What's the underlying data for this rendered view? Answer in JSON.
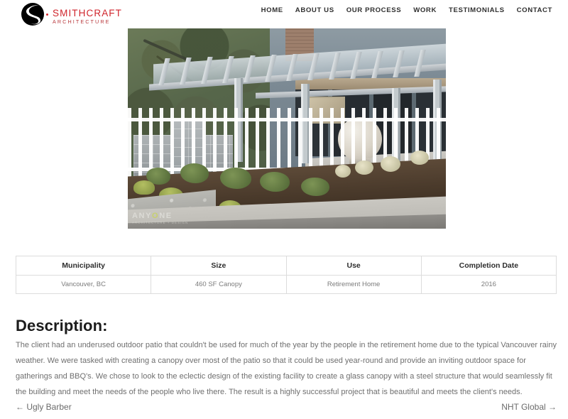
{
  "header": {
    "logo": {
      "name": "SMITHCRAFT",
      "subtitle": "ARCHITECTURE",
      "mark_color": "#000000",
      "name_color": "#d0252c"
    },
    "nav": [
      {
        "label": "HOME"
      },
      {
        "label": "ABOUT US"
      },
      {
        "label": "OUR PROCESS"
      },
      {
        "label": "WORK"
      },
      {
        "label": "TESTIMONIALS"
      },
      {
        "label": "CONTACT"
      }
    ]
  },
  "hero": {
    "alt": "White steel and glass canopy over a patio at a retirement home, with white picket fence, concrete block wall, stone sphere ornament and landscaped garden bed",
    "watermark": {
      "part1": "ANY",
      "highlight": "O",
      "part2": "NE",
      "subtitle": "ARCHITECTURE + DESIGN",
      "highlight_color": "#c9d93f"
    }
  },
  "spec_table": {
    "headers": [
      "Municipality",
      "Size",
      "Use",
      "Completion Date"
    ],
    "rows": [
      [
        "Vancouver, BC",
        "460 SF Canopy",
        "Retirement Home",
        "2016"
      ]
    ]
  },
  "description": {
    "title": "Description:",
    "body": "The client had an underused outdoor patio that couldn't be used for much of the year by the people in the retirement home due to the typical Vancouver rainy weather. We were tasked with creating a canopy over most of the patio so that it could be used year-round and provide an inviting outdoor space for gatherings and BBQ's. We chose to look to the eclectic design of the existing facility to create a glass canopy with a steel structure that would seamlessly fit the building and meet the needs of the people who live there. The result is a highly successful project that is beautiful and meets the client's needs."
  },
  "page_nav": {
    "previous": "← Ugly Barber",
    "next": "NHT Global →"
  }
}
